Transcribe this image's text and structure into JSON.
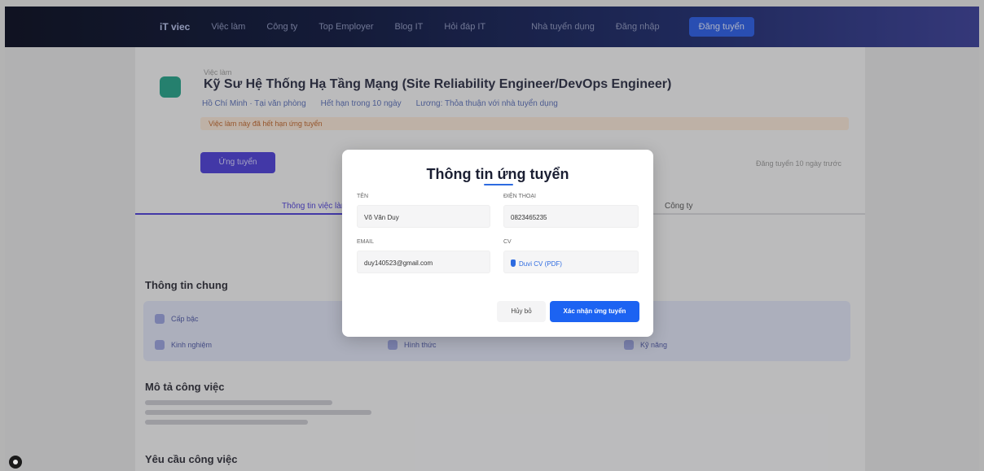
{
  "nav": {
    "logo": "iT viec",
    "items": [
      "Việc làm",
      "Công ty",
      "Top Employer",
      "Blog IT",
      "Hỏi đáp IT"
    ],
    "right_items": [
      "Nhà tuyển dụng",
      "Đăng nhập"
    ],
    "cta": "Đăng tuyển"
  },
  "job": {
    "breadcrumb": "Việc làm",
    "title": "Kỹ Sư Hệ Thống Hạ Tầng Mạng (Site Reliability Engineer/DevOps Engineer)",
    "meta": [
      "Hồ Chí Minh · Tại văn phòng",
      "Hết hạn trong 10 ngày",
      "Lương: Thỏa thuận với nhà tuyển dụng"
    ],
    "warning": "Việc làm này đã hết hạn ứng tuyển",
    "apply_label": "Ứng tuyển",
    "posted": "Đăng tuyển 10 ngày trước"
  },
  "tabs": [
    "Thông tin việc làm",
    "Công ty"
  ],
  "sections": {
    "general_title": "Thông tin chung",
    "info": [
      "Cấp bậc",
      "Kinh nghiệm",
      "Hình thức",
      "Kỹ năng"
    ],
    "description_title": "Mô tả công việc",
    "requirements_title": "Yêu cầu công việc"
  },
  "modal": {
    "title": "Thông tin ứng tuyển",
    "fields": {
      "name_label": "Tên",
      "name_value": "Võ Văn Duy",
      "phone_label": "Điện thoại",
      "phone_value": "0823465235",
      "email_label": "Email",
      "email_value": "duy140523@gmail.com",
      "cv_label": "CV",
      "cv_value": "Duvi CV (PDF)"
    },
    "cancel_label": "Hủy bỏ",
    "submit_label": "Xác nhận ứng tuyển"
  }
}
